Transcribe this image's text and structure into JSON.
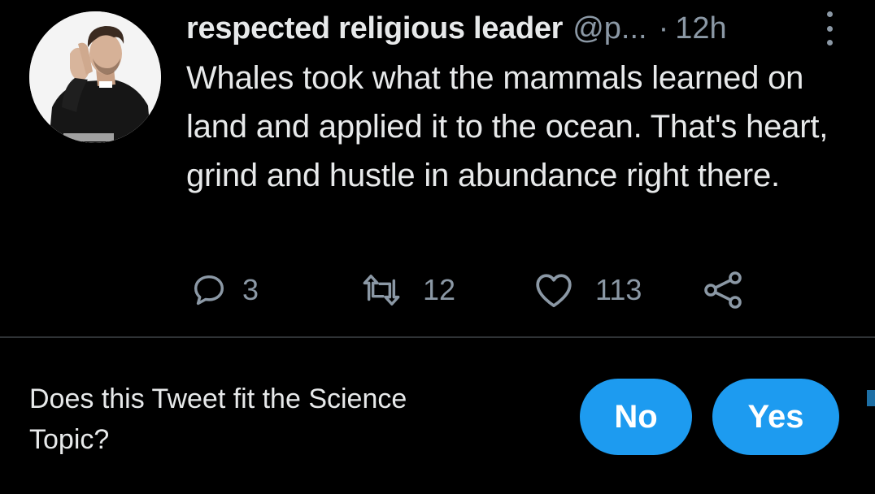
{
  "tweet": {
    "avatar_icon": "user-avatar-photo",
    "display_name": "respected religious leader",
    "handle": "@p...",
    "separator": "·",
    "timestamp": "12h",
    "text": "Whales took what the mammals learned on land and applied it to the ocean. That's heart, grind and hustle in abundance right there.",
    "more_icon": "vertical-ellipsis-icon",
    "actions": {
      "reply": {
        "icon": "reply-bubble-icon",
        "count": "3"
      },
      "retweet": {
        "icon": "retweet-icon",
        "count": "12"
      },
      "like": {
        "icon": "heart-icon",
        "count": "113"
      },
      "share": {
        "icon": "share-icon"
      }
    }
  },
  "topic_prompt": {
    "question": "Does this Tweet fit the Science Topic?",
    "no_label": "No",
    "yes_label": "Yes"
  },
  "colors": {
    "background": "#000000",
    "text_primary": "#e7e9ea",
    "text_secondary": "#8b98a5",
    "accent": "#1d9bf0",
    "divider": "#2f3336"
  }
}
